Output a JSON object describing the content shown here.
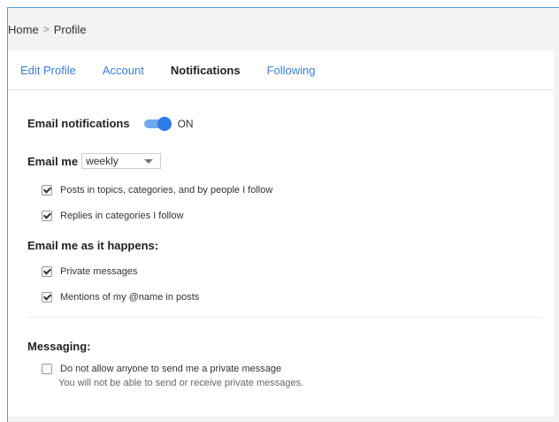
{
  "breadcrumb": {
    "home": "Home",
    "separator": ">",
    "current": "Profile"
  },
  "tabs": [
    {
      "label": "Edit Profile",
      "active": false
    },
    {
      "label": "Account",
      "active": false
    },
    {
      "label": "Notifications",
      "active": true
    },
    {
      "label": "Following",
      "active": false
    }
  ],
  "email_notifications": {
    "label": "Email notifications",
    "state_label": "ON",
    "enabled": true
  },
  "email_me": {
    "label": "Email me",
    "frequency": "weekly",
    "options": [
      {
        "label": "Posts in topics, categories, and by people I follow",
        "checked": true
      },
      {
        "label": "Replies in categories I follow",
        "checked": true
      }
    ]
  },
  "as_it_happens": {
    "label": "Email me as it happens:",
    "options": [
      {
        "label": "Private messages",
        "checked": true
      },
      {
        "label": "Mentions of my @name in posts",
        "checked": true
      }
    ]
  },
  "messaging": {
    "label": "Messaging:",
    "option": {
      "label": "Do not allow anyone to send me a private message",
      "checked": false
    },
    "note": "You will not be able to send or receive private messages."
  },
  "colors": {
    "accent": "#3b7dd8",
    "toggle_track": "#6fa8ef",
    "toggle_knob": "#2d7be5",
    "frame_border": "#4aa3e0"
  }
}
